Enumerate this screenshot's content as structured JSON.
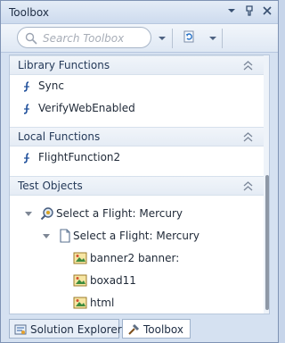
{
  "title": "Toolbox",
  "search": {
    "placeholder": "Search Toolbox"
  },
  "sections": [
    {
      "title": "Library Functions",
      "items": [
        "Sync",
        "VerifyWebEnabled"
      ]
    },
    {
      "title": "Local Functions",
      "items": [
        "FlightFunction2"
      ]
    },
    {
      "title": "Test Objects"
    }
  ],
  "tree": [
    "Select a Flight: Mercury",
    "Select a Flight: Mercury",
    "banner2 banner:",
    "boxad11",
    "html"
  ],
  "tabs": [
    {
      "label": "Solution Explorer"
    },
    {
      "label": "Toolbox"
    }
  ],
  "colors": {
    "accent": "#1f4f9b",
    "background": "#d5e1f1"
  },
  "icons": [
    "pin-icon",
    "dropdown-icon",
    "close-icon",
    "search-icon",
    "refresh-icon",
    "function-icon",
    "collapse-icon",
    "tree-arrow-icon",
    "browser-icon",
    "page-icon",
    "image-icon",
    "solution-icon",
    "toolbox-icon"
  ]
}
